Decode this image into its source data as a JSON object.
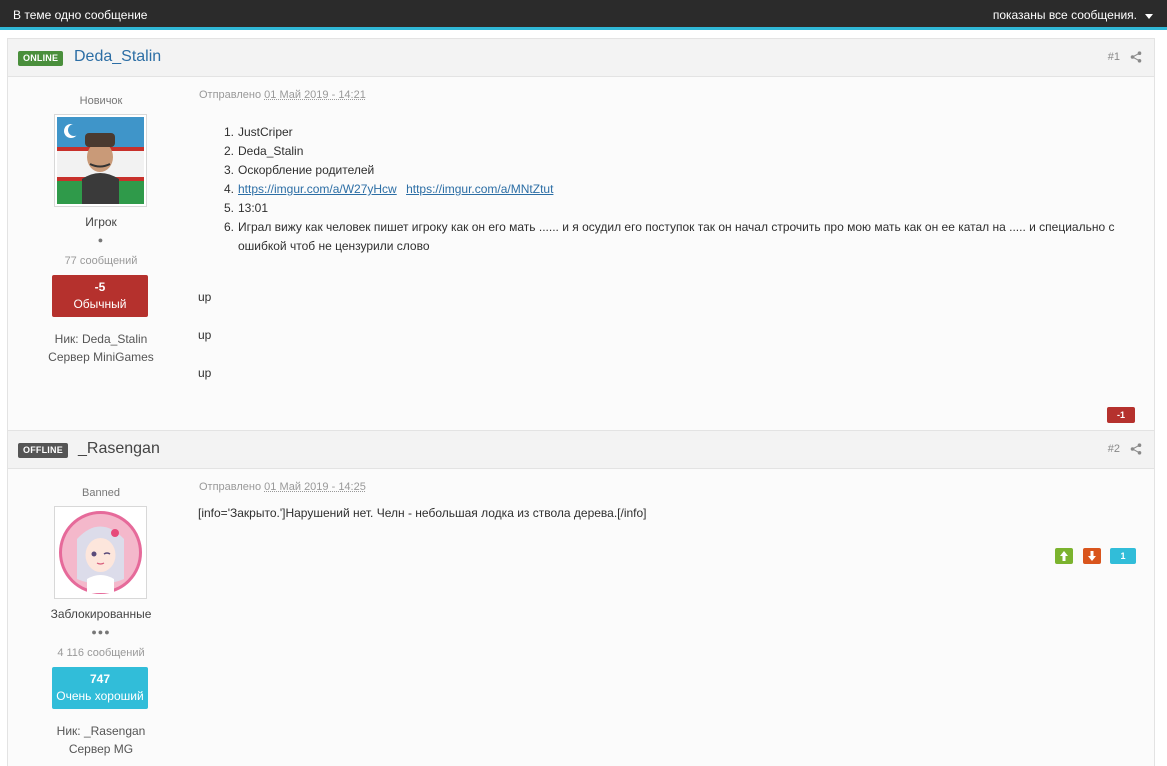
{
  "topbar": {
    "left_text": "В теме одно сообщение",
    "right_text": "показаны все сообщения.",
    "dropdown_icon": "caret-down-icon"
  },
  "posts": [
    {
      "status": "ONLINE",
      "author": "Deda_Stalin",
      "number": "#1",
      "rank": "Новичок",
      "group": "Игрок",
      "pips": "●",
      "post_count": "77 сообщений",
      "reputation": {
        "value": "-5",
        "label": "Обычный",
        "color": "#b5312d"
      },
      "nick_label": "Ник:",
      "nick": "Deda_Stalin",
      "server_label": "Сервер",
      "server": "MiniGames",
      "sent_label": "Отправлено",
      "date": "01 Май 2019 - 14:21",
      "list": [
        {
          "n": "1.",
          "text": "JustCriper"
        },
        {
          "n": "2.",
          "text": "Deda_Stalin"
        },
        {
          "n": "3.",
          "text": "Оскорбление родителей"
        },
        {
          "n": "4.",
          "link1": "https://imgur.com/a/W27yHcw",
          "link2": "https://imgur.com/a/MNtZtut"
        },
        {
          "n": "5.",
          "text": "13:01"
        },
        {
          "n": "6.",
          "text": "Играл вижу как человек пишет игроку как он его мать ...... и я осудил его поступок так он начал строчить про мою мать как он ее катал на ..... и специально с",
          "text2": "ошибкой чтоб не цензурили слово"
        }
      ],
      "ups": [
        "up",
        "up",
        "up"
      ],
      "vote_count": "-1"
    },
    {
      "status": "OFFLINE",
      "author": "_Rasengan",
      "number": "#2",
      "rank": "Banned",
      "group": "Заблокированные",
      "pips": "●●●",
      "post_count": "4 116 сообщений",
      "reputation": {
        "value": "747",
        "label": "Очень хороший",
        "color": "#31bdd9"
      },
      "nick_label": "Ник:",
      "nick": "_Rasengan",
      "server_label": "Сервер",
      "server": "MG",
      "sent_label": "Отправлено",
      "date": "01 Май 2019 - 14:25",
      "body": "[info='Закрыто.']Нарушений нет. Челн - небольшая лодка из ствола дерева.[/info]",
      "vote_count": "1"
    }
  ]
}
